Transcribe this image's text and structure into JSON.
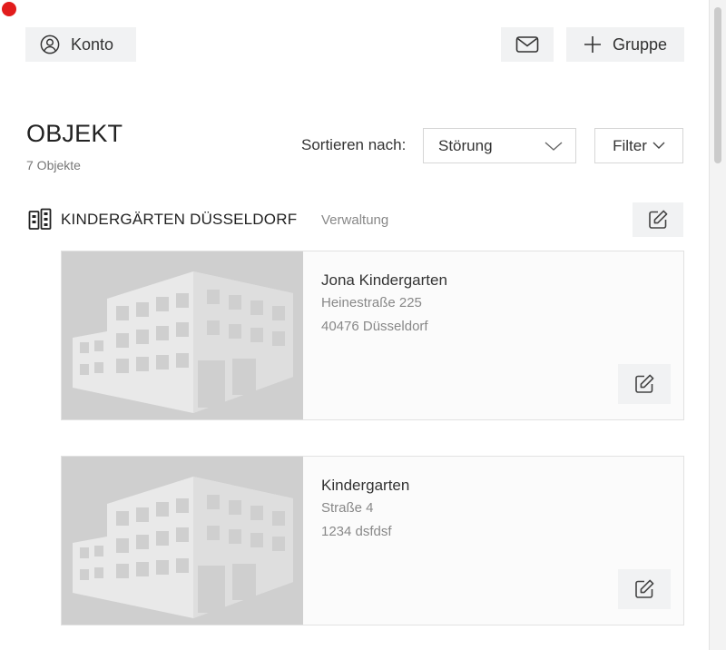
{
  "header": {
    "account_label": "Konto",
    "group_label": "Gruppe"
  },
  "page": {
    "title": "OBJEKT",
    "count": "7 Objekte"
  },
  "sort": {
    "label": "Sortieren nach:",
    "selected": "Störung"
  },
  "filter": {
    "label": "Filter"
  },
  "group": {
    "name": "KINDERGÄRTEN DÜSSELDORF",
    "role": "Verwaltung"
  },
  "objects": [
    {
      "name": "Jona Kindergarten",
      "street": "Heinestraße 225",
      "city": "40476 Düsseldorf"
    },
    {
      "name": "Kindergarten",
      "street": "Straße 4",
      "city": "1234 dsfdsf"
    }
  ],
  "colors": {
    "accent_dot": "#e21c1c",
    "button_bg": "#f1f2f3",
    "image_placeholder": "#cfcfcf"
  },
  "icons": [
    "account-icon",
    "mail-icon",
    "plus-icon",
    "chevron-down-icon",
    "building-group-icon",
    "edit-icon",
    "building-image"
  ]
}
